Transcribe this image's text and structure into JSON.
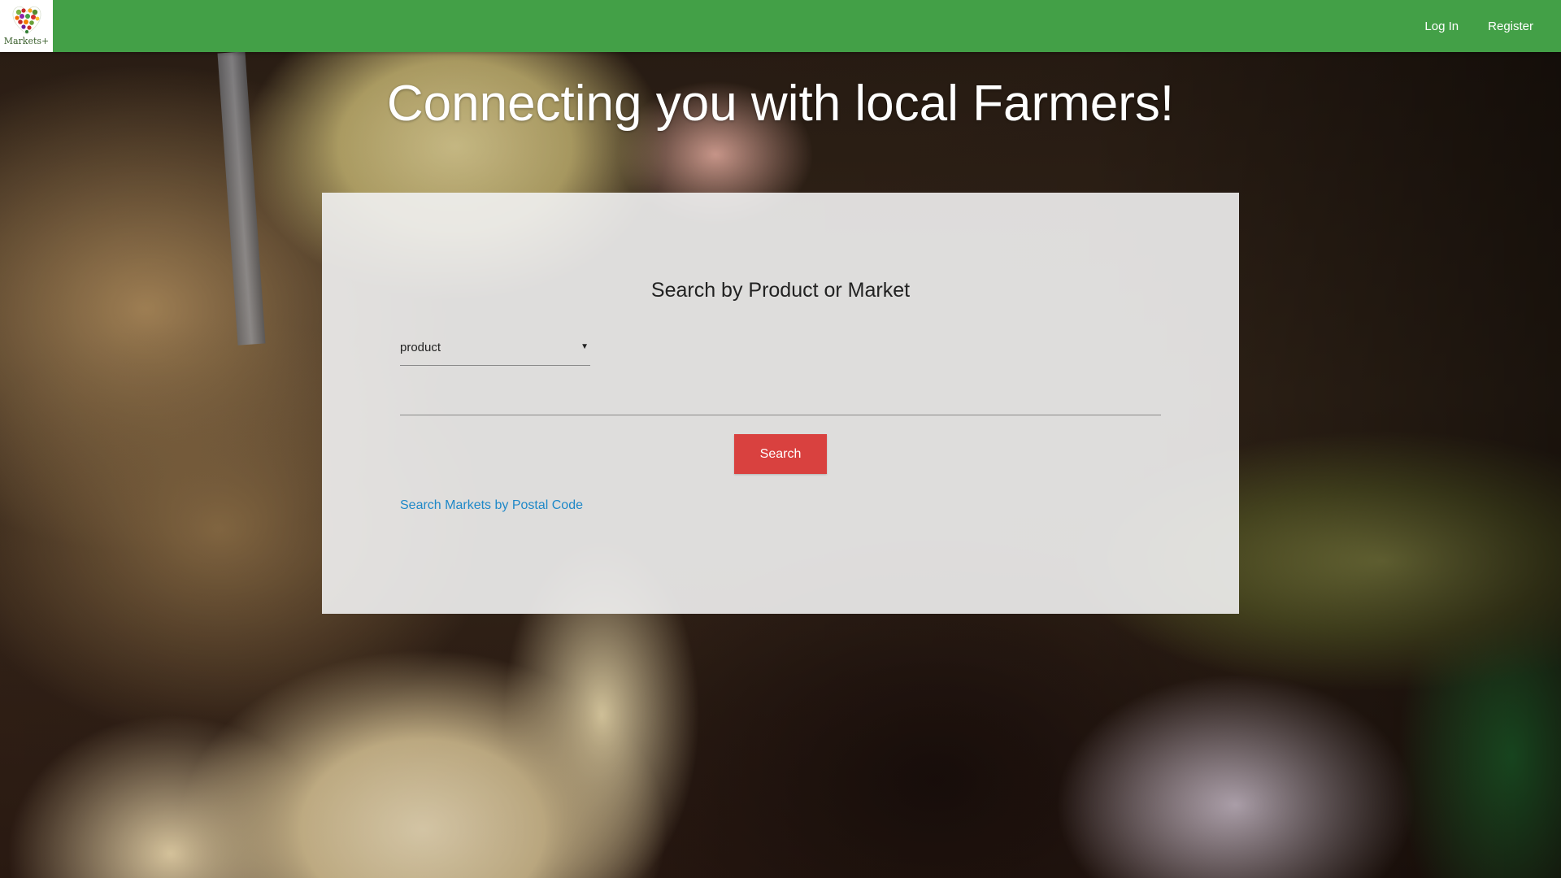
{
  "navbar": {
    "logo_text": "Markets+",
    "logo_icon": "heart-of-produce-logo",
    "links": {
      "login": "Log In",
      "register": "Register"
    },
    "background_color": "#43a047"
  },
  "hero": {
    "title": "Connecting you with local Farmers!"
  },
  "search_panel": {
    "title": "Search by Product or Market",
    "search_type": {
      "selected": "product",
      "icon": "caret-down-icon"
    },
    "query_input": {
      "value": "",
      "placeholder": ""
    },
    "search_button": "Search",
    "postal_link": "Search Markets by Postal Code",
    "colors": {
      "button": "#d9413f",
      "link": "#1e88c8"
    }
  }
}
